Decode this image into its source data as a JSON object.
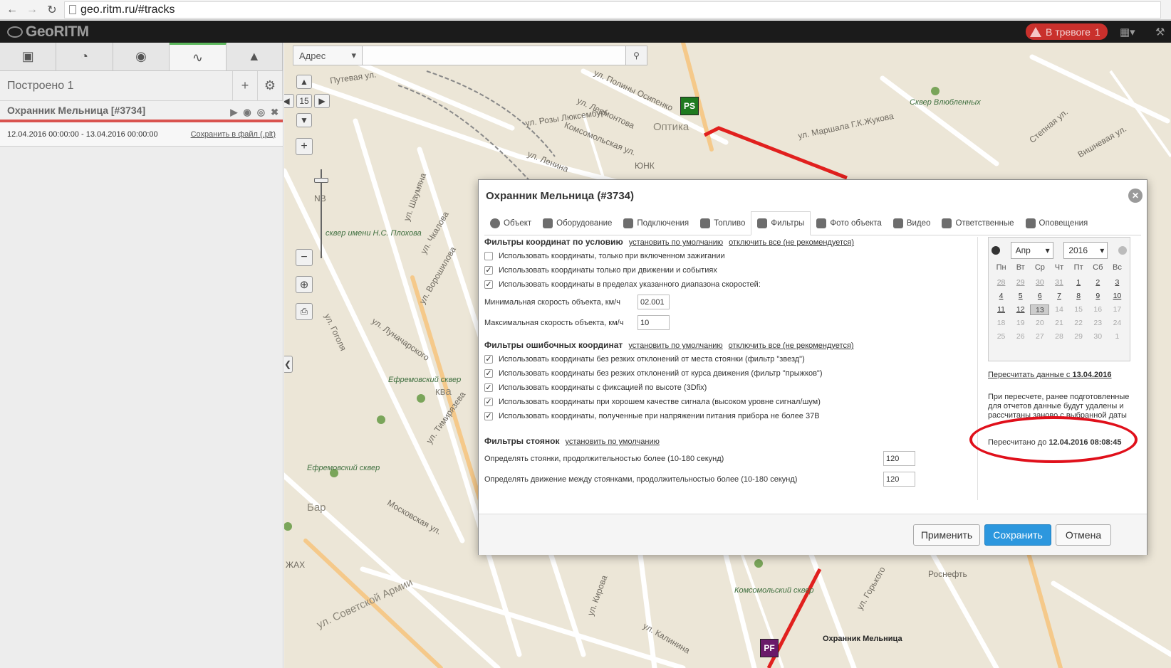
{
  "browser": {
    "url": "geo.ritm.ru/#tracks"
  },
  "header": {
    "logo": "GeoRITM",
    "alarm_label": "В тревоге",
    "alarm_count": "1"
  },
  "left": {
    "built_label": "Построено 1",
    "track_title": "Охранник Мельница [#3734]",
    "track_range": "12.04.2016 00:00:00 - 13.04.2016 00:00:00",
    "save_link": "Сохранить в файл (.plt)"
  },
  "map": {
    "search_type": "Адрес",
    "zoom_level": "15",
    "marker_start": "PS",
    "marker_end": "PF",
    "object_label": "Охранник Мельница",
    "labels": {
      "l1": "Путевая ул.",
      "l2": "ул. Полины Осипенко",
      "l3": "ул. Лермонтова",
      "l4": "ул. Розы Люксембург",
      "l5": "Оптика",
      "l6": "ул. Маршала Г.К.Жукова",
      "l7": "Комсомольская ул.",
      "l8": "ул. Ленина",
      "l9": "ЮНК",
      "l10": "Сквер Влюбленных",
      "l11": "Степная ул.",
      "l12": "Вишневая ул.",
      "l13": "ул. Шаумяна",
      "l14": "сквер имени Н.С. Плохова",
      "l15": "ул. Чкалова",
      "l16": "ул. Ворошилова",
      "l17": "ул. Гоголя",
      "l18": "ул. Луначарского",
      "l19": "Ефремовский сквер",
      "l20": "ул. Тимирязева",
      "l21": "Бар",
      "l22": "ЖАХ",
      "l23": "ул. Советской Армии",
      "l24": "Московская ул.",
      "l25": "Комсомольский сквер",
      "l26": "Роснефть",
      "l27": "ул. Кирова",
      "l28": "ул. Калинина",
      "l29": "NB",
      "l30": "Ефремовский сквер",
      "l31": "ква",
      "l32": "ул. Горького"
    }
  },
  "modal": {
    "title": "Охранник Мельница (#3734)",
    "tabs": [
      {
        "label": "Объект",
        "icon": "info-icon"
      },
      {
        "label": "Оборудование",
        "icon": "chip-icon"
      },
      {
        "label": "Подключения",
        "icon": "pulse-icon"
      },
      {
        "label": "Топливо",
        "icon": "fuel-icon"
      },
      {
        "label": "Фильтры",
        "icon": "filter-icon"
      },
      {
        "label": "Фото объекта",
        "icon": "camera-icon"
      },
      {
        "label": "Видео",
        "icon": "video-icon"
      },
      {
        "label": "Ответственные",
        "icon": "users-icon"
      },
      {
        "label": "Оповещения",
        "icon": "send-icon"
      }
    ],
    "sections": {
      "coord": {
        "title": "Фильтры координат по условию",
        "link_default": "установить по умолчанию",
        "link_disable": "отключить все (не рекомендуется)",
        "items": [
          {
            "label": "Использовать координаты, только при включенном зажигании",
            "checked": false
          },
          {
            "label": "Использовать координаты только при движении и событиях",
            "checked": true
          },
          {
            "label": "Использовать координаты в пределах указанного диапазона скоростей:",
            "checked": true
          }
        ],
        "min_speed_label": "Минимальная скорость объекта, км/ч",
        "min_speed_value": "02.001",
        "max_speed_label": "Максимальная скорость объекта, км/ч",
        "max_speed_value": "10"
      },
      "errors": {
        "title": "Фильтры ошибочных координат",
        "link_default": "установить по умолчанию",
        "link_disable": "отключить все (не рекомендуется)",
        "items": [
          {
            "label": "Использовать координаты без резких отклонений от места стоянки (фильтр \"звезд\")",
            "checked": true
          },
          {
            "label": "Использовать координаты без резких отклонений от курса движения (фильтр \"прыжков\")",
            "checked": true
          },
          {
            "label": "Использовать координаты с фиксацией по высоте (3Dfix)",
            "checked": true
          },
          {
            "label": "Использовать координаты при хорошем качестве сигнала (высоком уровне сигнал/шум)",
            "checked": true
          },
          {
            "label": "Использовать координаты, полученные при напряжении питания прибора не более 37В",
            "checked": true
          }
        ]
      },
      "stops": {
        "title": "Фильтры стоянок",
        "link_default": "установить по умолчанию",
        "stop_label": "Определять стоянки, продолжительностью более (10-180 секунд)",
        "stop_value": "120",
        "move_label": "Определять движение между стоянками, продолжительностью более (10-180 секунд)",
        "move_value": "120"
      }
    },
    "calendar": {
      "month": "Апр",
      "year": "2016",
      "weekdays": [
        "Пн",
        "Вт",
        "Ср",
        "Чт",
        "Пт",
        "Сб",
        "Вс"
      ],
      "weeks": [
        [
          "28",
          "29",
          "30",
          "31",
          "1",
          "2",
          "3"
        ],
        [
          "4",
          "5",
          "6",
          "7",
          "8",
          "9",
          "10"
        ],
        [
          "11",
          "12",
          "13",
          "14",
          "15",
          "16",
          "17"
        ],
        [
          "18",
          "19",
          "20",
          "21",
          "22",
          "23",
          "24"
        ],
        [
          "25",
          "26",
          "27",
          "28",
          "29",
          "30",
          "1"
        ]
      ]
    },
    "recalc_text": "Пересчитать данные с",
    "recalc_date": "13.04.2016",
    "note": "При пересчете, ранее подготовленные для отчетов данные будут удалены и рассчитаны заново с выбранной даты до настоящего момента.",
    "recalc_done_text": "Пересчитано до",
    "recalc_done_date": "12.04.2016 08:08:45",
    "buttons": {
      "apply": "Применить",
      "save": "Сохранить",
      "cancel": "Отмена"
    }
  }
}
